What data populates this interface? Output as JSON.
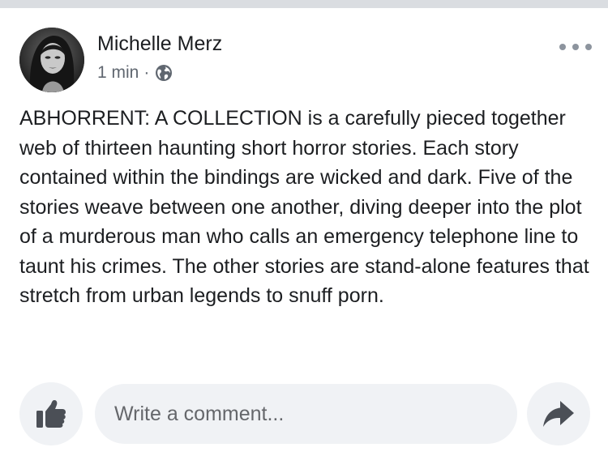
{
  "post": {
    "author": "Michelle Merz",
    "timestamp": "1 min",
    "separator": "·",
    "privacy_icon": "globe-icon",
    "more_icon": "more-options-icon",
    "text": "ABHORRENT: A COLLECTION is a carefully pieced together web of thirteen haunting short horror stories. Each story contained within the bindings are wicked and dark. Five of the stories weave between one another, diving deeper into the plot of a murderous man who calls an emergency telephone line to taunt his crimes. The other stories are stand-alone features that stretch from urban legends to snuff porn."
  },
  "actions": {
    "like_icon": "thumbs-up-icon",
    "comment_placeholder": "Write a comment...",
    "share_icon": "share-arrow-icon"
  },
  "colors": {
    "text_primary": "#1c1e21",
    "text_secondary": "#606770",
    "input_background": "#f0f2f5",
    "icon_dark": "#4b4f56"
  }
}
